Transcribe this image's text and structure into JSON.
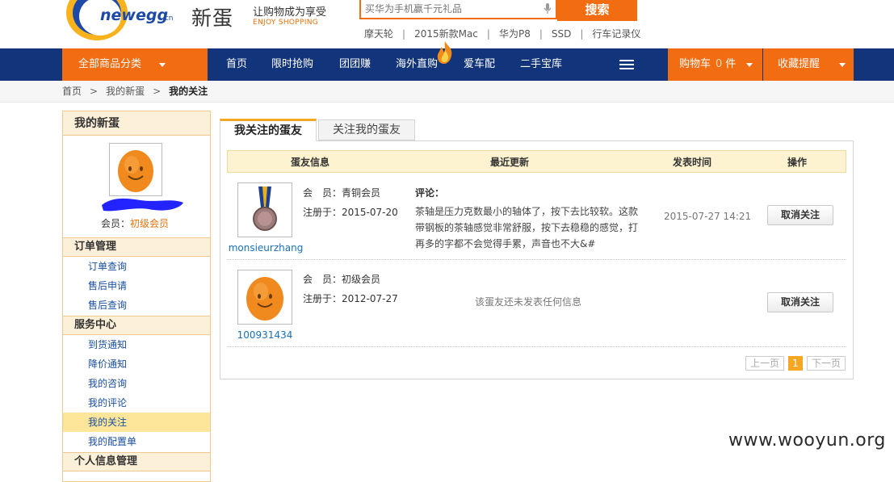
{
  "header": {
    "logo_text": "newegg",
    "logo_suffix": ".cn",
    "logo_cn": "新蛋",
    "slogan_cn": "让购物成为享受",
    "slogan_en": "ENJOY SHOPPING",
    "search": {
      "placeholder": "买华为手机赢千元礼品",
      "button_label": "搜索"
    },
    "hot_links": [
      "摩天轮",
      "2015新款Mac",
      "华为P8",
      "SSD",
      "行车记录仪"
    ]
  },
  "nav": {
    "all_categories": "全部商品分类",
    "items": [
      "首页",
      "限时抢购",
      "团团赚",
      "海外直购",
      "爱车配",
      "二手宝库"
    ],
    "cart_label": "购物车",
    "cart_count": "0",
    "cart_unit": "件",
    "favorites_label": "收藏提醒"
  },
  "breadcrumb": {
    "home": "首页",
    "mid": "我的新蛋",
    "current": "我的关注"
  },
  "sidebar": {
    "title": "我的新蛋",
    "member_label": "会员：",
    "member_level": "初级会员",
    "sections": [
      {
        "title": "订单管理",
        "links": [
          "订单查询",
          "售后申请",
          "售后查询"
        ]
      },
      {
        "title": "服务中心",
        "links": [
          "到货通知",
          "降价通知",
          "我的咨询",
          "我的评论",
          "我的关注",
          "我的配置单"
        ]
      },
      {
        "title": "个人信息管理",
        "links": []
      }
    ],
    "active_link": "我的关注"
  },
  "tabs": {
    "active": "我关注的蛋友",
    "other": "关注我的蛋友"
  },
  "table": {
    "headers": [
      "蛋友信息",
      "最近更新",
      "发表时间",
      "操作"
    ],
    "rows": [
      {
        "username": "monsieurzhang",
        "avatar": "bronze-medal",
        "member_label": "会　员：",
        "member_level": "青铜会员",
        "reg_label": "注册于：",
        "reg_date": "2015-07-20",
        "update_title": "评论：",
        "update_text": "茶轴是压力克数最小的轴体了，按下去比较软。这款带钢板的茶轴感觉非常舒服，按下去稳稳的感觉，打再多的字都不会觉得手累，声音也不大&#",
        "time": "2015-07-27 14:21",
        "action": "取消关注"
      },
      {
        "username": "100931434",
        "avatar": "orange-egg",
        "member_label": "会　员：",
        "member_level": "初级会员",
        "reg_label": "注册于：",
        "reg_date": "2012-07-27",
        "no_update": "该蛋友还未发表任何信息",
        "action": "取消关注"
      }
    ]
  },
  "pager": {
    "prev": "上一页",
    "current": "1",
    "next": "下一页"
  },
  "watermark": "www.wooyun.org",
  "colors": {
    "brand_orange": "#f26c12",
    "nav_blue": "#12347a",
    "link_blue": "#1a4fa0",
    "highlight": "#fde69a"
  }
}
